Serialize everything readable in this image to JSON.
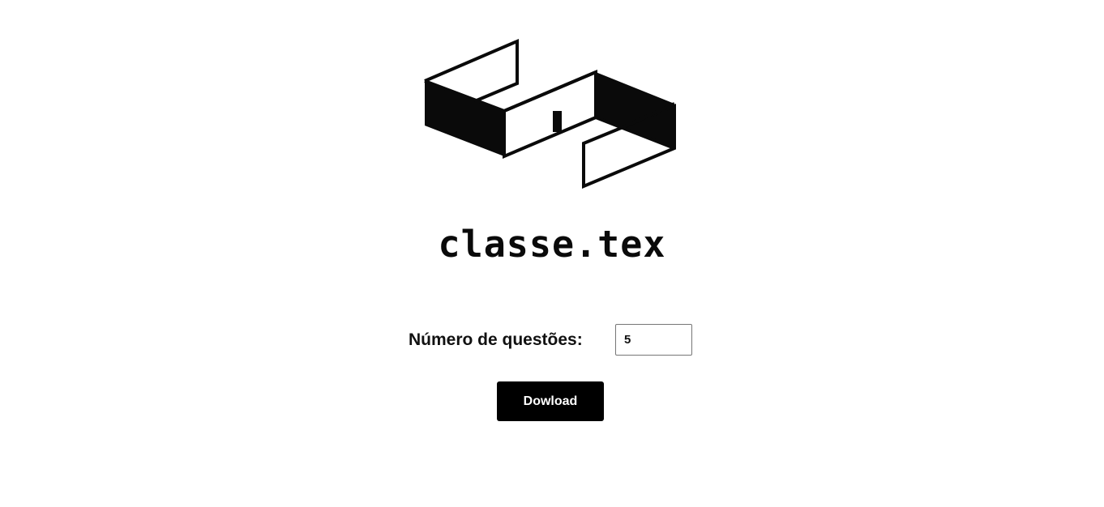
{
  "brand": {
    "logo_icon": "isometric-s-logo-icon",
    "title": "classe.tex"
  },
  "form": {
    "questions_label": "Número de questões:",
    "questions_value": "5"
  },
  "actions": {
    "download_label": "Dowload"
  },
  "colors": {
    "background": "#ffffff",
    "ink": "#0a0a0a",
    "button_bg": "#000000",
    "button_text": "#ffffff"
  }
}
